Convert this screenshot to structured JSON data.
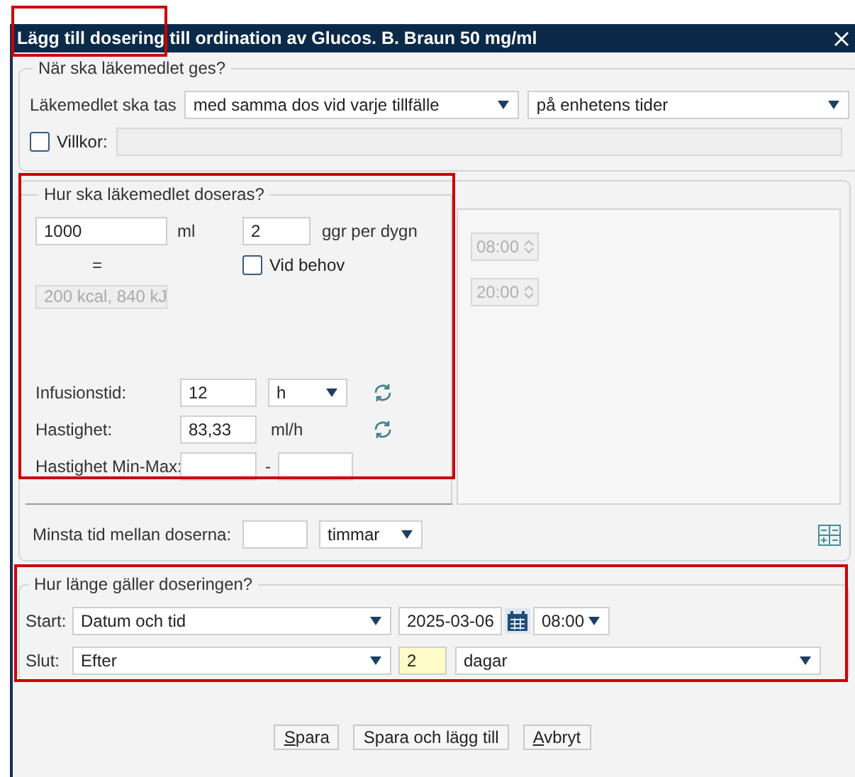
{
  "window": {
    "title": "Lägg till dosering till ordination av Glucos. B. Braun 50 mg/ml"
  },
  "when": {
    "legend": "När ska läkemedlet ges?",
    "take_label": "Läkemedlet ska tas",
    "take_mode": "med samma dos vid varje tillfälle",
    "schedule": "på enhetens tider",
    "condition": {
      "label": "Villkor:",
      "checked": false
    }
  },
  "dosing": {
    "legend": "Hur ska läkemedlet doseras?",
    "amount": "1000",
    "amount_unit": "ml",
    "times": "2",
    "times_unit": "ggr per dygn",
    "equals": "=",
    "as_needed": {
      "label": "Vid behov",
      "checked": false
    },
    "energy": "200 kcal, 840 kJ",
    "infusion_time": {
      "label": "Infusionstid:",
      "value": "12",
      "unit": "h"
    },
    "rate": {
      "label": "Hastighet:",
      "value": "83,33",
      "unit": "ml/h"
    },
    "rate_range": {
      "label": "Hastighet Min-Max:",
      "separator": "-"
    }
  },
  "times": [
    {
      "value": "08:00",
      "disabled": true
    },
    {
      "value": "20:00",
      "disabled": true
    }
  ],
  "min_interval": {
    "label": "Minsta tid mellan doserna:",
    "unit": "timmar"
  },
  "duration": {
    "legend": "Hur länge gäller doseringen?",
    "start": {
      "label": "Start:",
      "mode": "Datum och tid",
      "date": "2025-03-06",
      "time": "08:00"
    },
    "end": {
      "label": "Slut:",
      "mode": "Efter",
      "count": "2",
      "unit": "dagar"
    }
  },
  "buttons": [
    {
      "label": "Spara",
      "underline_first": true
    },
    {
      "label": "Spara och lägg till",
      "underline_first": false
    },
    {
      "label": "Avbryt",
      "underline_first": true
    }
  ]
}
